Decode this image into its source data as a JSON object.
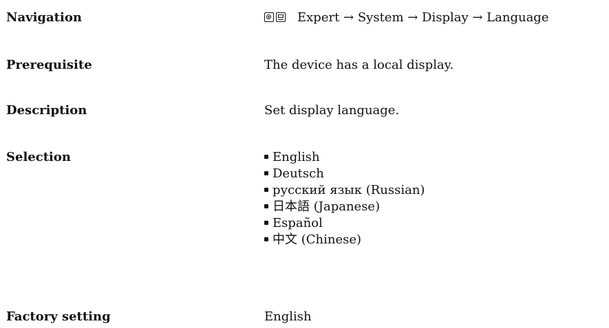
{
  "navigation": {
    "label": "Navigation",
    "icons": [
      "keypad-icon",
      "screen-icon"
    ],
    "path": "Expert → System → Display → Language"
  },
  "prerequisite": {
    "label": "Prerequisite",
    "text": "The device has a local display."
  },
  "description": {
    "label": "Description",
    "text": "Set display language."
  },
  "selection": {
    "label": "Selection",
    "items": [
      "English",
      "Deutsch",
      "русский язык (Russian)",
      "日本語 (Japanese)",
      "Español",
      "中文 (Chinese)"
    ]
  },
  "factory_setting": {
    "label": "Factory setting",
    "value": "English"
  }
}
